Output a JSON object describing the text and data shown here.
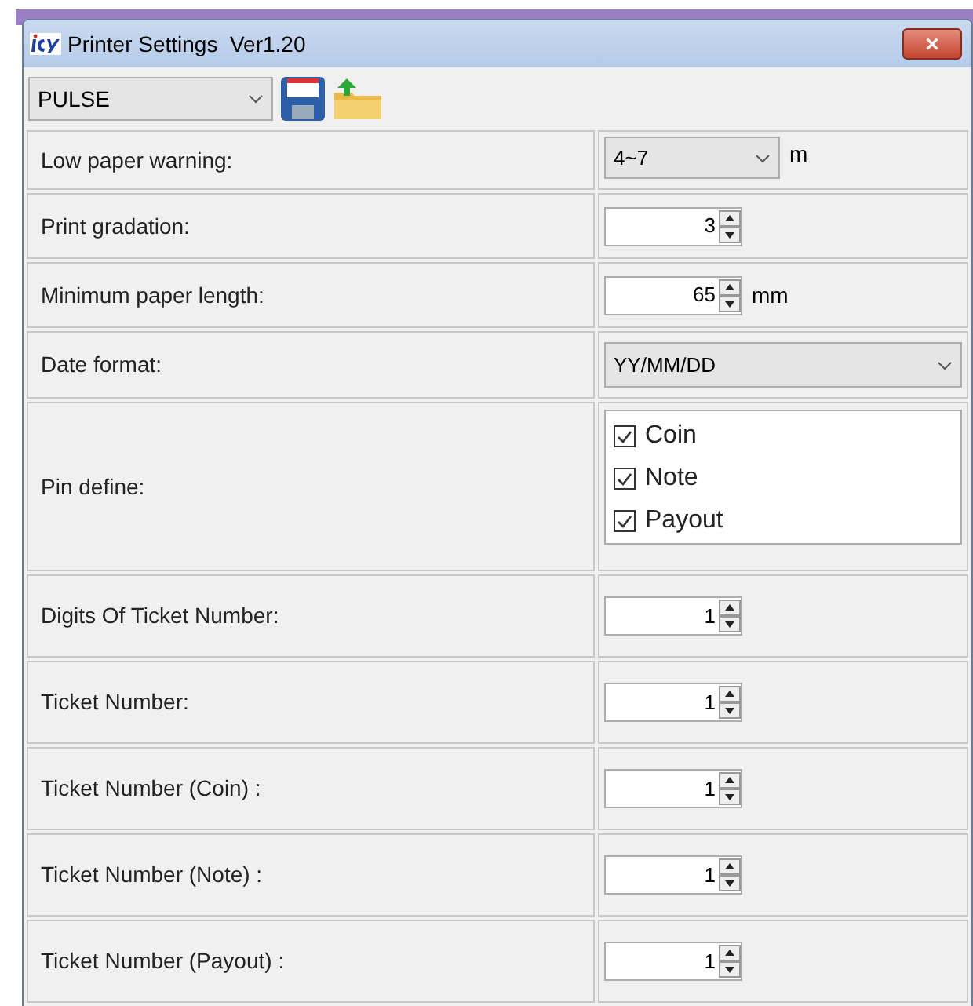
{
  "window": {
    "title": "Printer Settings  Ver1.20",
    "close_label": "×"
  },
  "toolbar": {
    "profile": "PULSE"
  },
  "settings": [
    {
      "label": "Low paper warning:",
      "kind": "dropdown",
      "value": "4~7",
      "unit": "m"
    },
    {
      "label": "Print gradation:",
      "kind": "spin",
      "value": "3"
    },
    {
      "label": "Minimum paper length:",
      "kind": "spin",
      "value": "65",
      "unit": "mm"
    },
    {
      "label": "Date format:",
      "kind": "wide-dropdown",
      "value": "YY/MM/DD"
    },
    {
      "label": "Pin define:",
      "kind": "checklist",
      "options": [
        {
          "label": "Coin",
          "checked": true
        },
        {
          "label": "Note",
          "checked": true
        },
        {
          "label": "Payout",
          "checked": true
        }
      ]
    },
    {
      "label": "Digits Of Ticket Number:",
      "kind": "spin",
      "value": "1"
    },
    {
      "label": "Ticket Number:",
      "kind": "spin",
      "value": "1"
    },
    {
      "label": "Ticket Number (Coin) :",
      "kind": "spin",
      "value": "1"
    },
    {
      "label": "Ticket Number (Note) :",
      "kind": "spin",
      "value": "1"
    },
    {
      "label": "Ticket Number (Payout) :",
      "kind": "spin",
      "value": "1"
    }
  ]
}
